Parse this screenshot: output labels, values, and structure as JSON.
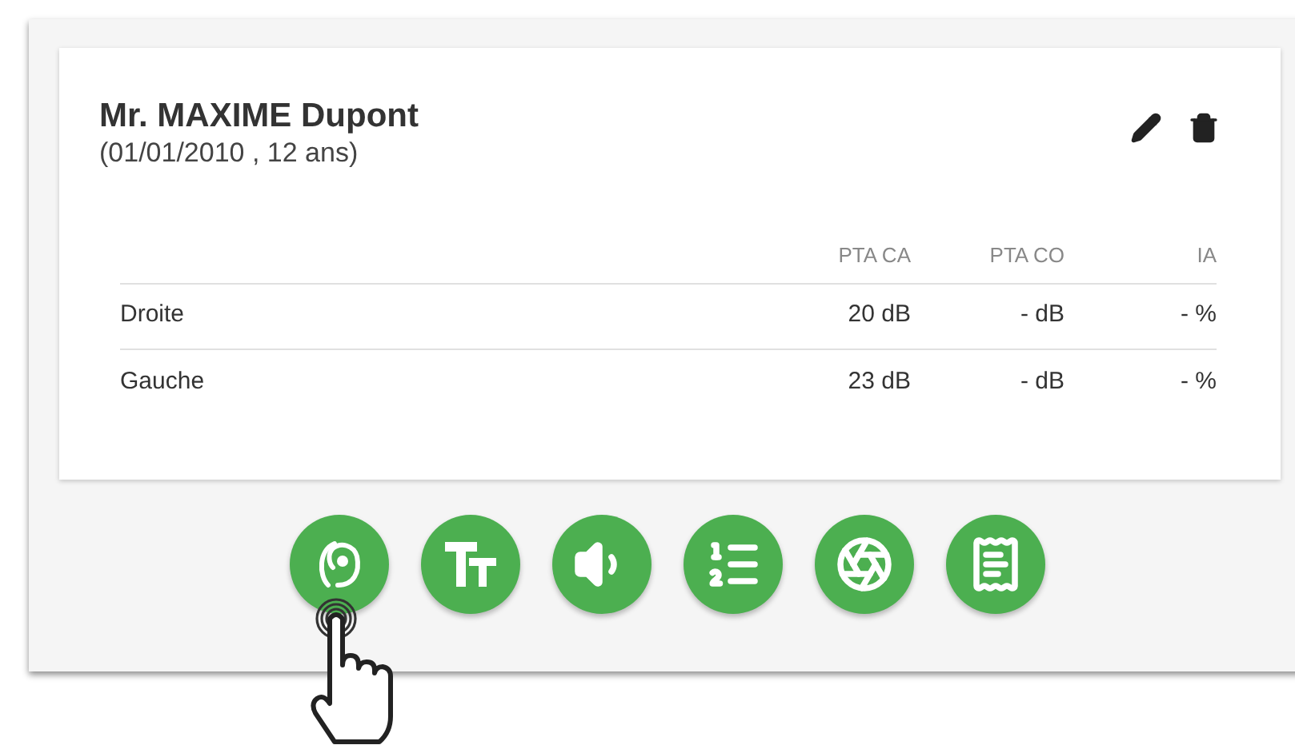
{
  "patient": {
    "name": "Mr. MAXIME Dupont",
    "details": "(01/01/2010 , 12 ans)"
  },
  "table": {
    "columns": [
      "PTA CA",
      "PTA CO",
      "IA"
    ],
    "rows": [
      {
        "side": "Droite",
        "cells": [
          "20 dB",
          "- dB",
          "- %"
        ]
      },
      {
        "side": "Gauche",
        "cells": [
          "23 dB",
          "- dB",
          "- %"
        ]
      }
    ]
  },
  "actions": [
    {
      "kind": "ear"
    },
    {
      "kind": "text-size"
    },
    {
      "kind": "volume"
    },
    {
      "kind": "list"
    },
    {
      "kind": "aperture"
    },
    {
      "kind": "receipt"
    }
  ]
}
